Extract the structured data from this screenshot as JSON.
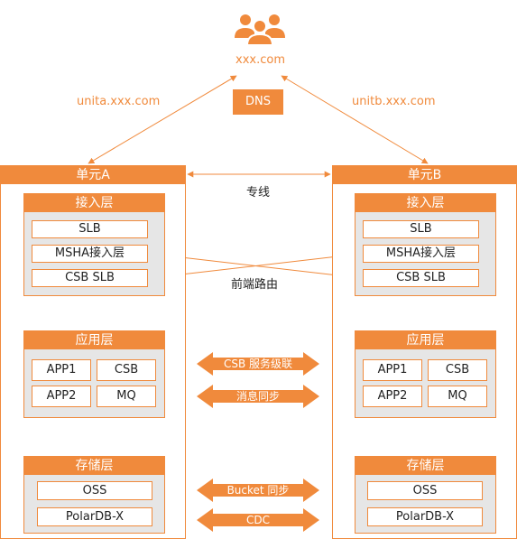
{
  "top": {
    "domain": "xxx.com",
    "dns": "DNS",
    "left_domain": "unita.xxx.com",
    "right_domain": "unitb.xxx.com"
  },
  "links": {
    "dedicated": "专线",
    "frontend_route": "前端路由"
  },
  "units": [
    {
      "title": "单元A",
      "access": {
        "title": "接入层",
        "items": [
          "SLB",
          "MSHA接入层",
          "CSB SLB"
        ]
      },
      "app": {
        "title": "应用层",
        "items": [
          "APP1",
          "CSB",
          "APP2",
          "MQ"
        ]
      },
      "storage": {
        "title": "存储层",
        "items": [
          "OSS",
          "PolarDB-X"
        ]
      }
    },
    {
      "title": "单元B",
      "access": {
        "title": "接入层",
        "items": [
          "SLB",
          "MSHA接入层",
          "CSB SLB"
        ]
      },
      "app": {
        "title": "应用层",
        "items": [
          "APP1",
          "CSB",
          "APP2",
          "MQ"
        ]
      },
      "storage": {
        "title": "存储层",
        "items": [
          "OSS",
          "PolarDB-X"
        ]
      }
    }
  ],
  "sync_arrows": [
    "CSB 服务级联",
    "消息同步",
    "Bucket 同步",
    "CDC"
  ],
  "colors": {
    "accent": "#f08a3c",
    "layer_bg": "#e6e6e6"
  },
  "icons": {
    "users": "users-icon"
  }
}
